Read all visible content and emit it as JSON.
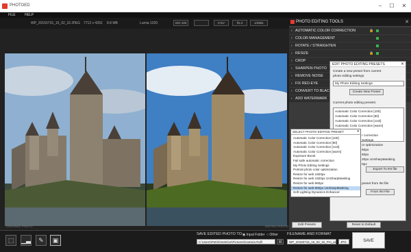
{
  "window": {
    "title": "PHOTOED",
    "minimize": "–",
    "maximize": "☐",
    "close": "✕"
  },
  "menu": [
    "FILE",
    "HELP"
  ],
  "info": {
    "filename": "WP_20150715_15_02_32",
    "format": "JPEG",
    "dimensions": "7712 x 4352",
    "filesize": "8.8 MB",
    "camera": "Lumia 1020",
    "iso": "ISO 100",
    "exposure": "0 EV",
    "aperture": "f/2.2",
    "shutter": "1/4681"
  },
  "photos": {
    "original_label": "ORIGINAL PHOTO",
    "edited_label": "EDITED PHOTO"
  },
  "tools_panel": {
    "title": "PHOTO EDITING TOOLS",
    "items": [
      {
        "label": "AUTOMATIC COLOR CORRECTION",
        "locked": true,
        "active": true
      },
      {
        "label": "COLOR MANAGEMENT",
        "locked": false,
        "active": true
      },
      {
        "label": "ROTATE / STRAIGHTEN",
        "locked": false,
        "active": true
      },
      {
        "label": "RESIZE",
        "locked": true,
        "active": true
      },
      {
        "label": "CROP",
        "locked": false,
        "active": false
      },
      {
        "label": "SHARPEN PHOTO",
        "locked": false,
        "active": false
      },
      {
        "label": "REMOVE NOISE",
        "locked": false,
        "active": false
      },
      {
        "label": "FIX RED-EYE",
        "locked": false,
        "active": false
      },
      {
        "label": "CONVERT TO BLACK",
        "locked": false,
        "active": false
      },
      {
        "label": "ADD WATERMARK",
        "locked": false,
        "active": false
      }
    ],
    "edit_presets_button": "Edit Presets",
    "reset_button": "Reset to Default",
    "reload_button": "Reload"
  },
  "dialog": {
    "title": "EDIT PHOTO EDITING PRESETS",
    "create_text_1": "Create a new preset from current",
    "create_text_2": "photo editing settings",
    "name_value": "My Photo Editing Settings",
    "create_button": "Create New Preset",
    "current_label": "Current photo editing presets:",
    "presets": [
      "Automatic Color Correction [100]",
      "Automatic Color Correction [80]",
      "Automatic Color Correction [cool]",
      "Automatic Color Correction [warm]"
    ],
    "partial_lines": [
      "r correction",
      "Settings",
      "or optimization",
      "60px",
      "60px",
      "20px UnSharpMasking",
      "0px"
    ],
    "export_button": "Export To INI file",
    "import_text": "preset from INI file",
    "import_button": "From INI File"
  },
  "dropdown": {
    "header": "SELECT PHOTO EDITING PRESET",
    "items": [
      "Automatic Color Correction [100]",
      "Automatic Color Correction [80]",
      "Automatic Color Correction [cool]",
      "Automatic Color Correction [warm]",
      "Exposure Boost",
      "Fail safe automatic correction",
      "My Photo Editing Settings",
      "Portrait photo color optimization",
      "Resize for web 1920px",
      "Resize for web 1920px UnSharpMasking",
      "Resize for web 960px",
      "Resize for web 960px UnSharpMasking",
      "Soft Lighting Dynamics Enhancer"
    ],
    "selected_index": 11
  },
  "bottom": {
    "save_to_label": "SAVE EDITED PHOTO TO:",
    "radio_input": "Input Folder",
    "radio_other": "Other",
    "path": "C:\\Users\\Petri\\OneDrive\\Pictures\\Camera Roll\\",
    "filename_label": "FILENAME AND FORMAT",
    "filename": "WP_20150715_15_02_32_Pro_ac",
    "format": "JPG",
    "save_button": "SAVE"
  }
}
